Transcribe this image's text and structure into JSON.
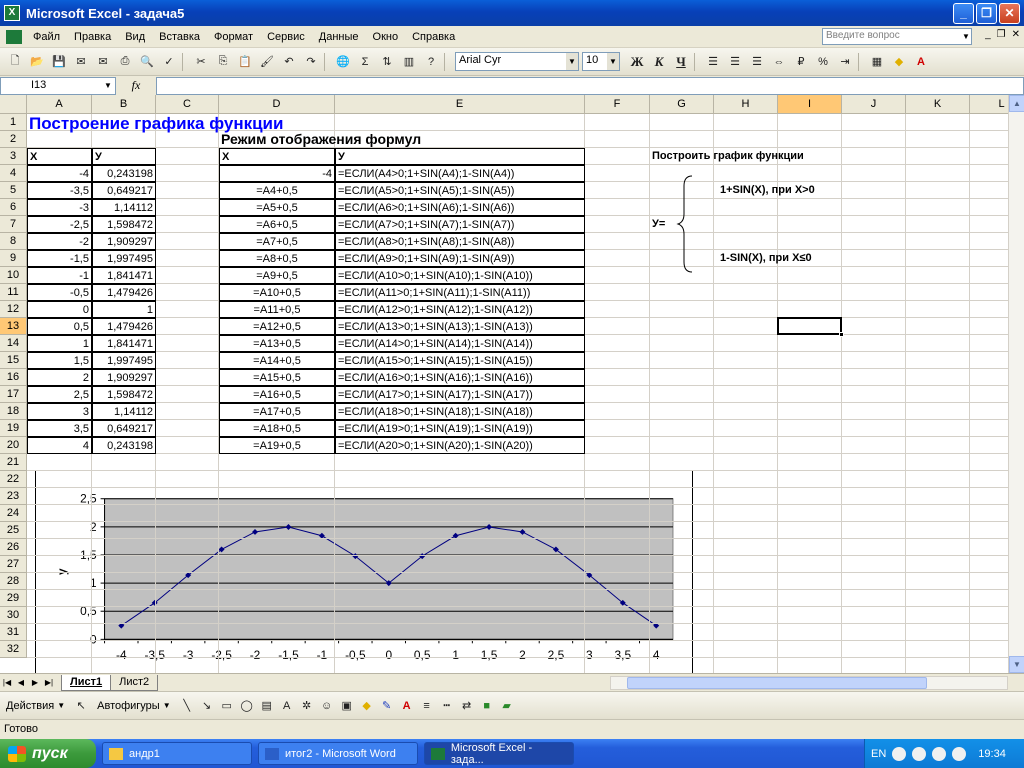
{
  "window": {
    "title": "Microsoft Excel - задача5",
    "app_icon_glyph": "X"
  },
  "menu": {
    "items": [
      "Файл",
      "Правка",
      "Вид",
      "Вставка",
      "Формат",
      "Сервис",
      "Данные",
      "Окно",
      "Справка"
    ],
    "help_placeholder": "Введите вопрос",
    "mdi_minimize": "_",
    "mdi_restore": "❐",
    "mdi_close": "✕"
  },
  "toolbar": {
    "font_name": "Arial Cyr",
    "font_size": "10",
    "bold_label": "Ж",
    "italic_label": "К",
    "underline_label": "Ч",
    "percent_label": "%"
  },
  "formula_bar": {
    "name_box": "I13",
    "fx_label": "fx",
    "formula": ""
  },
  "columns": [
    "A",
    "B",
    "C",
    "D",
    "E",
    "F",
    "G",
    "H",
    "I",
    "J",
    "K",
    "L"
  ],
  "selected_column": "I",
  "selected_row": 13,
  "rows_visible": 32,
  "sheet": {
    "title": "Построение графика функции",
    "formula_mode_title": "Режим отображения формул",
    "header_x": "X",
    "header_y": "У",
    "header_x2": "X",
    "header_y2": "У",
    "a_values": [
      "-4",
      "-3,5",
      "-3",
      "-2,5",
      "-2",
      "-1,5",
      "-1",
      "-0,5",
      "0",
      "0,5",
      "1",
      "1,5",
      "2",
      "2,5",
      "3",
      "3,5",
      "4"
    ],
    "b_values": [
      "0,243198",
      "0,649217",
      "1,14112",
      "1,598472",
      "1,909297",
      "1,997495",
      "1,841471",
      "1,479426",
      "1",
      "1,479426",
      "1,841471",
      "1,997495",
      "1,909297",
      "1,598472",
      "1,14112",
      "0,649217",
      "0,243198"
    ],
    "d_values": [
      "-4",
      "=A4+0,5",
      "=A5+0,5",
      "=A6+0,5",
      "=A7+0,5",
      "=A8+0,5",
      "=A9+0,5",
      "=A10+0,5",
      "=A11+0,5",
      "=A12+0,5",
      "=A13+0,5",
      "=A14+0,5",
      "=A15+0,5",
      "=A16+0,5",
      "=A17+0,5",
      "=A18+0,5",
      "=A19+0,5"
    ],
    "e_values": [
      "=ЕСЛИ(A4>0;1+SIN(A4);1-SIN(A4))",
      "=ЕСЛИ(A5>0;1+SIN(A5);1-SIN(A5))",
      "=ЕСЛИ(A6>0;1+SIN(A6);1-SIN(A6))",
      "=ЕСЛИ(A7>0;1+SIN(A7);1-SIN(A7))",
      "=ЕСЛИ(A8>0;1+SIN(A8);1-SIN(A8))",
      "=ЕСЛИ(A9>0;1+SIN(A9);1-SIN(A9))",
      "=ЕСЛИ(A10>0;1+SIN(A10);1-SIN(A10))",
      "=ЕСЛИ(A11>0;1+SIN(A11);1-SIN(A11))",
      "=ЕСЛИ(A12>0;1+SIN(A12);1-SIN(A12))",
      "=ЕСЛИ(A13>0;1+SIN(A13);1-SIN(A13))",
      "=ЕСЛИ(A14>0;1+SIN(A14);1-SIN(A14))",
      "=ЕСЛИ(A15>0;1+SIN(A15);1-SIN(A15))",
      "=ЕСЛИ(A16>0;1+SIN(A16);1-SIN(A16))",
      "=ЕСЛИ(A17>0;1+SIN(A17);1-SIN(A17))",
      "=ЕСЛИ(A18>0;1+SIN(A18);1-SIN(A18))",
      "=ЕСЛИ(A19>0;1+SIN(A19);1-SIN(A19))",
      "=ЕСЛИ(A20>0;1+SIN(A20);1-SIN(A20))"
    ],
    "task_title": "Построить график функции",
    "case_positive": "1+SIN(X), при X>0",
    "case_nonpositive": "1-SIN(X), при X≤0",
    "y_label": "У="
  },
  "chart_data": {
    "type": "line",
    "title": "",
    "xlabel": "",
    "ylabel": "у",
    "categories": [
      "-4",
      "-3,5",
      "-3",
      "-2,5",
      "-2",
      "-1,5",
      "-1",
      "-0,5",
      "0",
      "0,5",
      "1",
      "1,5",
      "2",
      "2,5",
      "3",
      "3,5",
      "4"
    ],
    "series": [
      {
        "values": [
          0.243198,
          0.649217,
          1.14112,
          1.598472,
          1.909297,
          1.997495,
          1.841471,
          1.479426,
          1,
          1.479426,
          1.841471,
          1.997495,
          1.909297,
          1.598472,
          1.14112,
          0.649217,
          0.243198
        ]
      }
    ],
    "ylim": [
      0,
      2.5
    ],
    "yticks": [
      "0",
      "0,5",
      "1",
      "1,5",
      "2",
      "2,5"
    ],
    "grid": true,
    "plot_bg": "#c0c0c0",
    "line_color": "#000080"
  },
  "sheet_tabs": {
    "tabs": [
      "Лист1",
      "Лист2"
    ],
    "active": "Лист1"
  },
  "drawbar": {
    "actions_label": "Действия",
    "autoshapes_label": "Автофигуры"
  },
  "status": {
    "text": "Готово"
  },
  "taskbar": {
    "start_label": "пуск",
    "tasks": [
      "андр1",
      "итог2 - Microsoft Word",
      "Microsoft Excel - зада..."
    ],
    "lang": "EN",
    "clock": "19:34"
  }
}
